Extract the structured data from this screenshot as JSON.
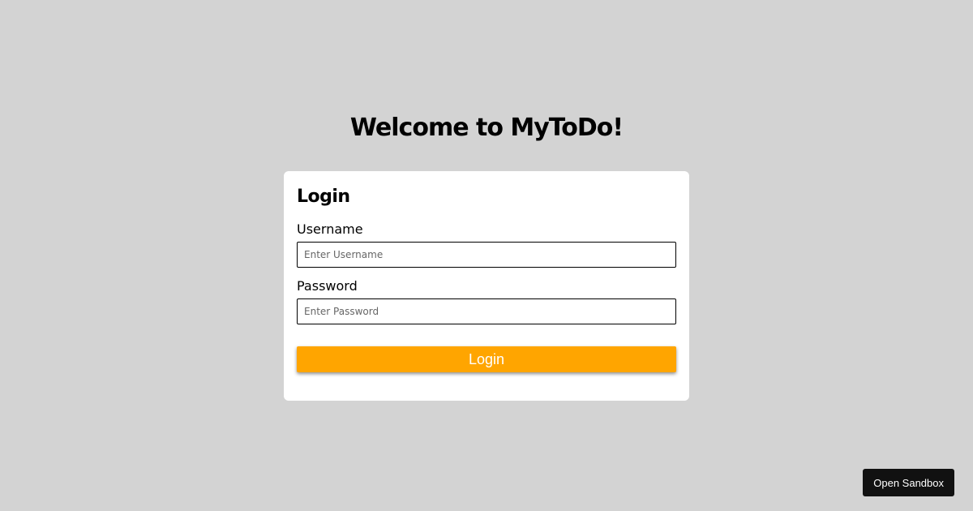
{
  "header": {
    "title": "Welcome to MyToDo!"
  },
  "login": {
    "title": "Login",
    "username_label": "Username",
    "username_placeholder": "Enter Username",
    "username_value": "",
    "password_label": "Password",
    "password_placeholder": "Enter Password",
    "password_value": "",
    "submit_label": "Login"
  },
  "sandbox": {
    "label": "Open Sandbox"
  },
  "colors": {
    "background": "#d3d3d3",
    "card": "#ffffff",
    "accent": "#ffa500",
    "sandbox_button": "#111111"
  }
}
